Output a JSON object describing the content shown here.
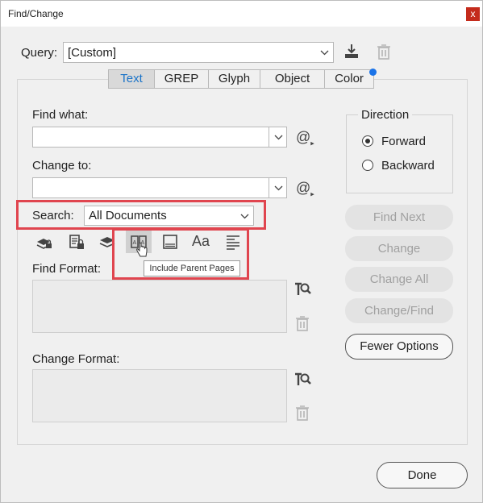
{
  "window": {
    "title": "Find/Change",
    "close_label": "x"
  },
  "query": {
    "label": "Query:",
    "value": "[Custom]"
  },
  "tabs": [
    {
      "label": "Text",
      "active": true
    },
    {
      "label": "GREP",
      "active": false
    },
    {
      "label": "Glyph",
      "active": false
    },
    {
      "label": "Object",
      "active": false
    },
    {
      "label": "Color",
      "active": false
    }
  ],
  "find_what": {
    "label": "Find what:",
    "value": "",
    "special_chars": "@"
  },
  "change_to": {
    "label": "Change to:",
    "value": "",
    "special_chars": "@"
  },
  "search": {
    "label": "Search:",
    "value": "All Documents"
  },
  "direction": {
    "title": "Direction",
    "options": [
      {
        "label": "Forward",
        "selected": true
      },
      {
        "label": "Backward",
        "selected": false
      }
    ]
  },
  "options_toolbar": {
    "icons": [
      "include-locked-layers-icon",
      "include-locked-stories-icon",
      "include-hidden-layers-icon",
      "include-parent-pages-icon",
      "include-footnotes-icon",
      "case-sensitive-icon",
      "whole-word-icon"
    ],
    "case_glyph": "Aa",
    "tooltip": "Include Parent Pages"
  },
  "find_format": {
    "label": "Find Format:"
  },
  "change_format": {
    "label": "Change Format:"
  },
  "buttons": {
    "find_next": "Find Next",
    "change": "Change",
    "change_all": "Change All",
    "change_find": "Change/Find",
    "fewer_options": "Fewer Options",
    "done": "Done"
  },
  "colors": {
    "accent": "#1a73e8",
    "highlight": "#e0454f",
    "active_tab_text": "#1a73c8"
  }
}
